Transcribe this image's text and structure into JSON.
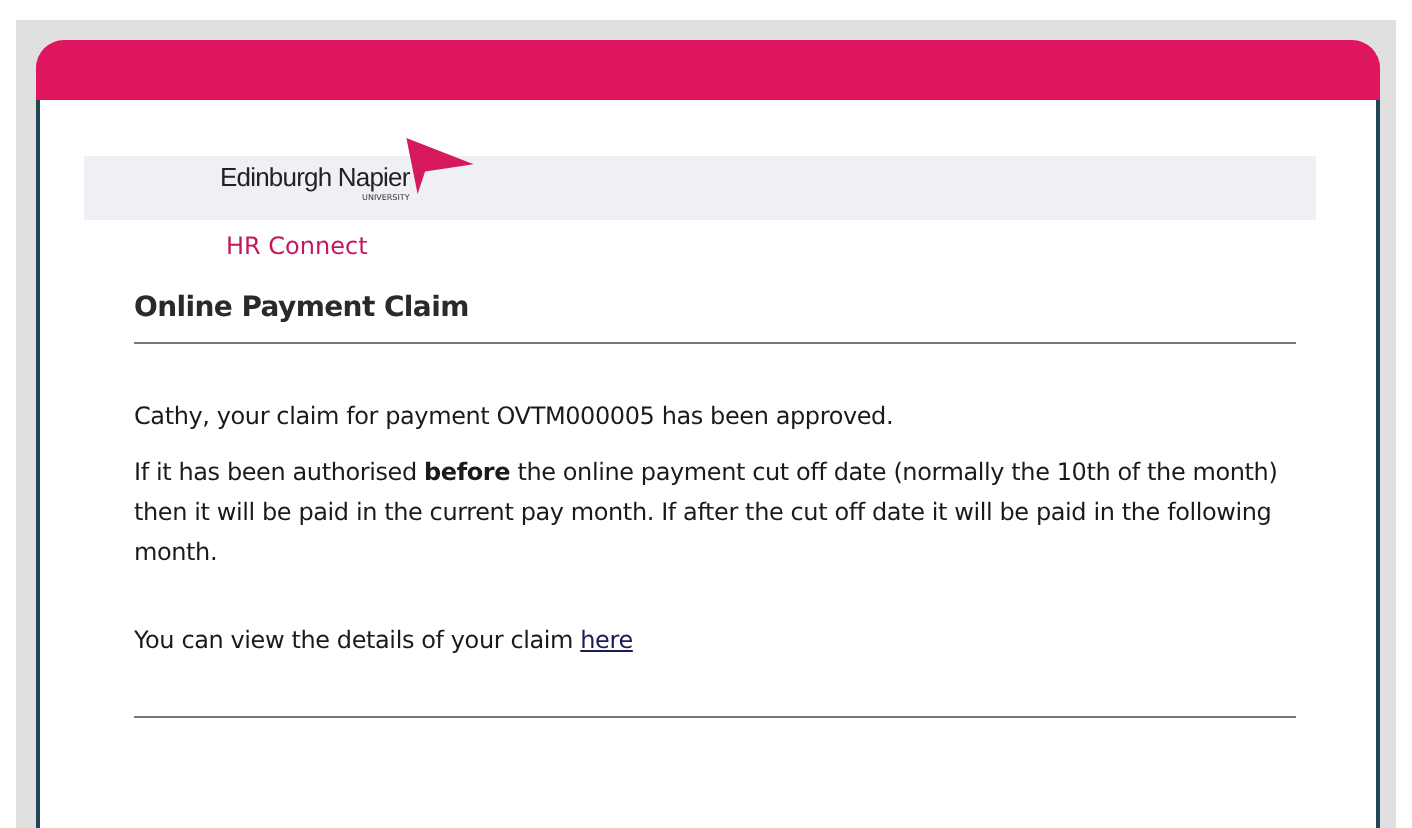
{
  "brand": {
    "name": "Edinburgh Napier",
    "subtitle": "UNIVERSITY",
    "portal": "HR Connect"
  },
  "message": {
    "title": "Online Payment Claim",
    "paragraphs": [
      "Cathy, your claim for payment OVTM000005 has been approved.",
      "If it has been authorised **before** the online payment cut off date (normally the 10th of the month) then it will be paid in the current pay month. If after the cut off date it will be paid in the following month."
    ],
    "link_sentence": "You can view the details of your claim",
    "link": "here"
  }
}
